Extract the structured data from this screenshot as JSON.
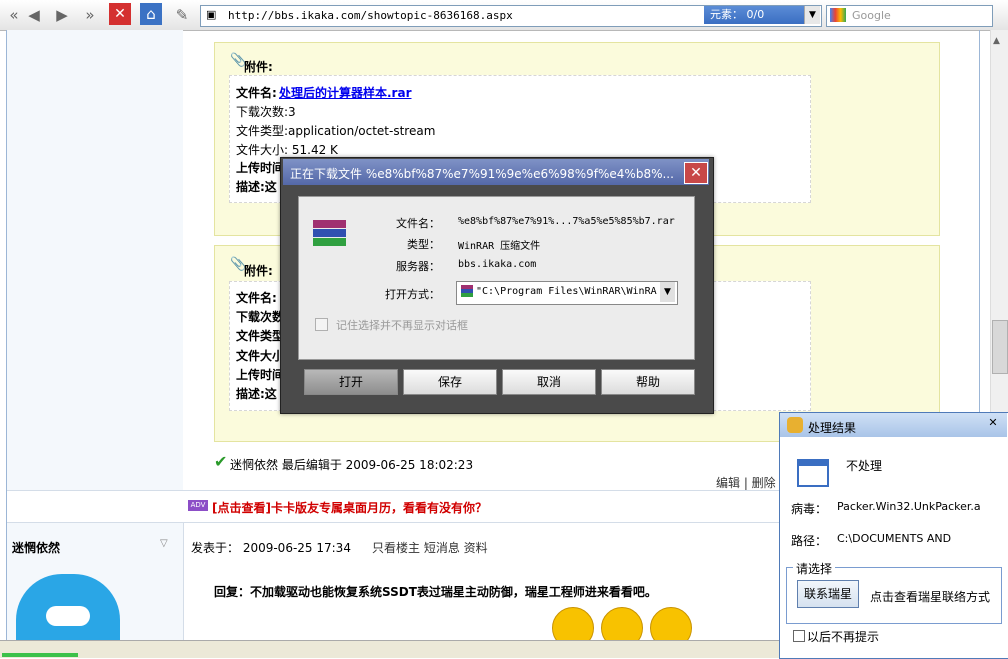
{
  "browser": {
    "address_url": "http://bbs.ikaka.com/showtopic-8636168.aspx",
    "address_status": "元素：   0/0",
    "search_placeholder": "Google"
  },
  "attachment1": {
    "header": "附件:",
    "filename_label": "文件名:",
    "filename": "处理后的计算器样本.rar",
    "downloads": "下载次数:3",
    "filetype": "文件类型:application/octet-stream",
    "filesize": "文件大小: 51.42 K",
    "upload_time": "上传时间",
    "description": "描述:这"
  },
  "attachment2": {
    "header": "附件:",
    "filename_label": "文件名:",
    "downloads": "下载次数",
    "filetype": "文件类型",
    "filesize": "文件大小",
    "upload_time": "上传时间",
    "description": "描述:这"
  },
  "edit_note": "迷惘依然 最后编辑于 2009-06-25 18:02:23",
  "edit_links": "编辑 | 删除 |",
  "ad": {
    "badge": "ADV",
    "text": "[点击查看]卡卡版友专属桌面月历，看看有没有你？"
  },
  "post2": {
    "author": "迷惘依然",
    "posted": "发表于：  2009-06-25 17:34",
    "links": "只看楼主   短消息 资料",
    "reply": "回复：不加载驱动也能恢复系统SSDT表过瑞星主动防御，瑞星工程师进来看看吧。"
  },
  "dialog": {
    "title": "正在下载文件 %e8%bf%87%e7%91%9e%e6%98%9f%e4%b8%...",
    "close": "✕",
    "filename_label": "文件名：",
    "filename": "%e8%bf%87%e7%91%...7%a5%e5%85%b7.rar",
    "type_label": "类型：",
    "type": "WinRAR 压缩文件",
    "server_label": "服务器：",
    "server": "bbs.ikaka.com",
    "openwith_label": "打开方式：",
    "openwith": "\"C:\\Program Files\\WinRAR\\WinRA",
    "remember": "记住选择并不再显示对话框",
    "buttons": [
      "打开",
      "保存",
      "取消",
      "帮助"
    ]
  },
  "popup": {
    "title": "处理结果",
    "close": "✕",
    "action": "不处理",
    "virus_label": "病毒：",
    "virus": "Packer.Win32.UnkPacker.a",
    "path_label": "路径：",
    "path": "C:\\DOCUMENTS AND",
    "group_label": "请选择",
    "contact_button": "联系瑞星",
    "contact_link": "点击查看瑞星联络方式",
    "dont_show": "以后不再提示"
  }
}
